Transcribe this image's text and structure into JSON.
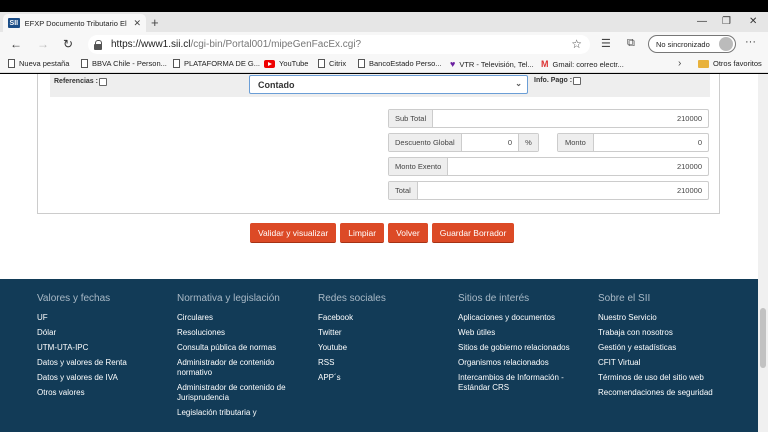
{
  "browser": {
    "tab_title": "EFXP Documento Tributario Electr",
    "favicon_text": "SII",
    "url_host": "https://www1.sii.cl",
    "url_path": "/cgi-bin/Portal001/mipeGenFacEx.cgi?",
    "sync_label": "No sincronizado"
  },
  "bookmarks": [
    {
      "label": "Nueva pestaña",
      "icon": "page-icon"
    },
    {
      "label": "BBVA Chile - Person...",
      "icon": "page-icon"
    },
    {
      "label": "PLATAFORMA DE G...",
      "icon": "page-icon"
    },
    {
      "label": "YouTube",
      "icon": "youtube-icon"
    },
    {
      "label": "Citrix",
      "icon": "page-icon"
    },
    {
      "label": "BancoEstado Perso...",
      "icon": "page-icon"
    },
    {
      "label": "VTR - Televisión, Tel...",
      "icon": "vtr-icon"
    },
    {
      "label": "Gmail: correo electr...",
      "icon": "gmail-icon"
    }
  ],
  "bookmarks_other": "Otros favoritos",
  "form": {
    "referencias_label": "Referencias :",
    "forma_pago_value": "Contado",
    "info_pago_label": "Info. Pago :",
    "subtotal_label": "Sub Total",
    "subtotal_value": "210000",
    "descuento_label": "Descuento Global",
    "descuento_value": "0",
    "pct_symbol": "%",
    "monto_label": "Monto",
    "monto_value": "0",
    "exento_label": "Monto Exento",
    "exento_value": "210000",
    "total_label": "Total",
    "total_value": "210000"
  },
  "buttons": {
    "validar": "Validar y visualizar",
    "limpiar": "Limpiar",
    "volver": "Volver",
    "guardar": "Guardar Borrador"
  },
  "footer": {
    "columns": [
      {
        "title": "Valores y fechas",
        "items": [
          "UF",
          "Dólar",
          "UTM-UTA-IPC",
          "Datos y valores de Renta",
          "Datos y valores de IVA",
          "Otros valores"
        ]
      },
      {
        "title": "Normativa y legislación",
        "items": [
          "Circulares",
          "Resoluciones",
          "Consulta pública de normas",
          "Administrador de contenido normativo",
          "Administrador de contenido de Jurisprudencia",
          "Legislación tributaria y"
        ]
      },
      {
        "title": "Redes sociales",
        "items": [
          "Facebook",
          "Twitter",
          "Youtube",
          "RSS",
          "APP´s"
        ]
      },
      {
        "title": "Sitios de interés",
        "items": [
          "Aplicaciones y documentos",
          "Web útiles",
          "Sitios de gobierno relacionados",
          "Organismos relacionados",
          "Intercambios de Información - Estándar CRS"
        ]
      },
      {
        "title": "Sobre el SII",
        "items": [
          "Nuestro Servicio",
          "Trabaja con nosotros",
          "Gestión y estadísticas",
          "CFIT Virtual",
          "Términos de uso del sitio web",
          "Recomendaciones de seguridad"
        ]
      }
    ]
  }
}
